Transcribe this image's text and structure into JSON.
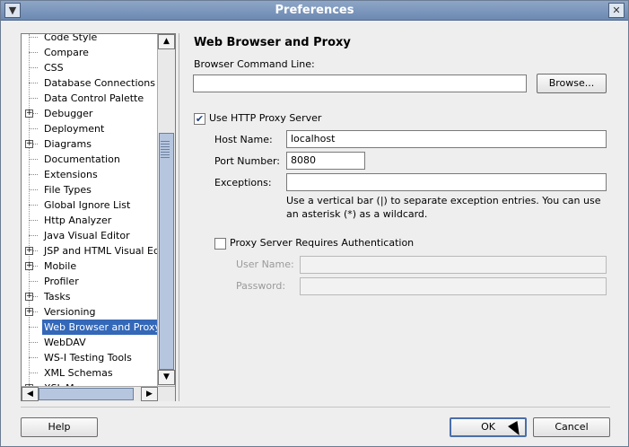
{
  "window": {
    "title": "Preferences"
  },
  "tree": {
    "items": [
      {
        "label": "Code Style",
        "expandable": false,
        "selected": false
      },
      {
        "label": "Compare",
        "expandable": false,
        "selected": false
      },
      {
        "label": "CSS",
        "expandable": false,
        "selected": false
      },
      {
        "label": "Database Connections",
        "expandable": false,
        "selected": false
      },
      {
        "label": "Data Control Palette",
        "expandable": false,
        "selected": false
      },
      {
        "label": "Debugger",
        "expandable": true,
        "selected": false
      },
      {
        "label": "Deployment",
        "expandable": false,
        "selected": false
      },
      {
        "label": "Diagrams",
        "expandable": true,
        "selected": false
      },
      {
        "label": "Documentation",
        "expandable": false,
        "selected": false
      },
      {
        "label": "Extensions",
        "expandable": false,
        "selected": false
      },
      {
        "label": "File Types",
        "expandable": false,
        "selected": false
      },
      {
        "label": "Global Ignore List",
        "expandable": false,
        "selected": false
      },
      {
        "label": "Http Analyzer",
        "expandable": false,
        "selected": false
      },
      {
        "label": "Java Visual Editor",
        "expandable": false,
        "selected": false
      },
      {
        "label": "JSP and HTML Visual Edit",
        "expandable": true,
        "selected": false
      },
      {
        "label": "Mobile",
        "expandable": true,
        "selected": false
      },
      {
        "label": "Profiler",
        "expandable": false,
        "selected": false
      },
      {
        "label": "Tasks",
        "expandable": true,
        "selected": false
      },
      {
        "label": "Versioning",
        "expandable": true,
        "selected": false
      },
      {
        "label": "Web Browser and Proxy",
        "expandable": false,
        "selected": true
      },
      {
        "label": "WebDAV",
        "expandable": false,
        "selected": false
      },
      {
        "label": "WS-I Testing Tools",
        "expandable": false,
        "selected": false
      },
      {
        "label": "XML Schemas",
        "expandable": false,
        "selected": false
      },
      {
        "label": "XSL Maps",
        "expandable": true,
        "selected": false
      }
    ]
  },
  "panel": {
    "title": "Web Browser and Proxy",
    "browser_command_label": "Browser Command Line:",
    "browser_command_value": "",
    "browse_button": "Browse...",
    "use_proxy_label": "Use HTTP Proxy Server",
    "use_proxy_checked": true,
    "host_label": "Host Name:",
    "host_value": "localhost",
    "port_label": "Port Number:",
    "port_value": "8080",
    "exceptions_label": "Exceptions:",
    "exceptions_value": "",
    "help_text": "Use a vertical bar (|) to separate exception entries.  You can use an asterisk (*) as a wildcard.",
    "auth_label": "Proxy Server Requires Authentication",
    "auth_checked": false,
    "user_label": "User Name:",
    "user_value": "",
    "password_label": "Password:",
    "password_value": ""
  },
  "footer": {
    "help_button": "Help",
    "ok_button": "OK",
    "cancel_button": "Cancel"
  },
  "colors": {
    "selection": "#3468b8",
    "titlebar": "#7b96bc"
  }
}
